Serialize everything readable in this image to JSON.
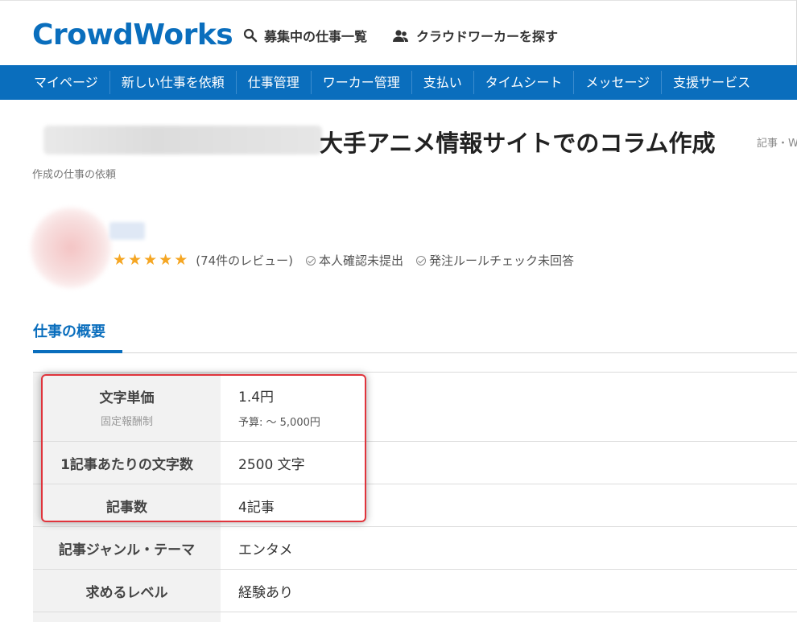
{
  "header": {
    "logo": "CrowdWorks",
    "links": [
      {
        "label": "募集中の仕事一覧",
        "icon": "search-icon"
      },
      {
        "label": "クラウドワーカーを探す",
        "icon": "users-icon"
      }
    ]
  },
  "nav": {
    "items": [
      "マイページ",
      "新しい仕事を依頼",
      "仕事管理",
      "ワーカー管理",
      "支払い",
      "タイムシート",
      "メッセージ",
      "支援サービス"
    ]
  },
  "job": {
    "title": "大手アニメ情報サイトでのコラム作成",
    "category_trail": "記事・W",
    "subtitle": "作成の仕事の依頼"
  },
  "client": {
    "rating_stars": 5,
    "reviews": "(74件のレビュー)",
    "identity_status": "本人確認未提出",
    "rule_status": "発注ルールチェック未回答"
  },
  "section": {
    "tab_label": "仕事の概要"
  },
  "spec": {
    "rows": [
      {
        "label": "文字単価",
        "label_sub": "固定報酬制",
        "value": "1.4円",
        "value_sub": "予算: ～ 5,000円"
      },
      {
        "label": "1記事あたりの文字数",
        "value": "2500 文字"
      },
      {
        "label": "記事数",
        "value": "4記事"
      },
      {
        "label": "記事ジャンル・テーマ",
        "value": "エンタメ"
      },
      {
        "label": "求めるレベル",
        "value": "経験あり"
      },
      {
        "label": "",
        "value": ""
      }
    ]
  },
  "colors": {
    "brand": "#0a6ebd",
    "star": "#f5a623",
    "highlight": "#e0343c"
  }
}
